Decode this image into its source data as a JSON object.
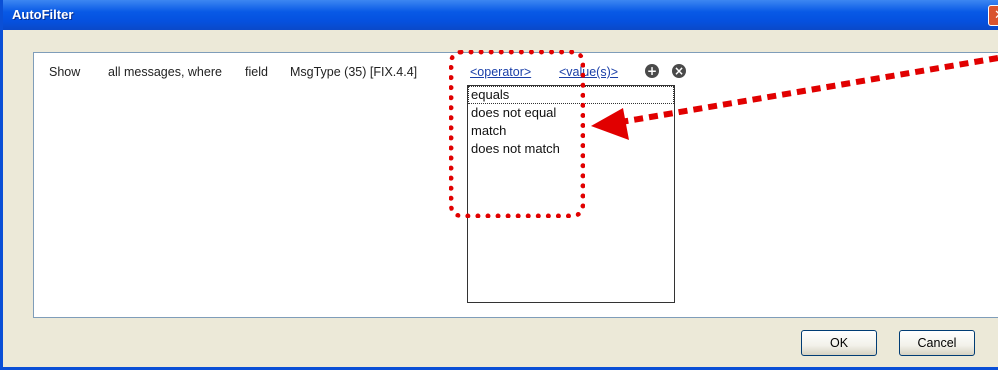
{
  "window": {
    "title": "AutoFilter",
    "close_glyph": "✕"
  },
  "filter_row": {
    "show": "Show",
    "scope": "all messages, where",
    "field_label": "field",
    "field_value": "MsgType (35) [FIX.4.4]",
    "operator_link": "<operator>",
    "value_link": "<value(s)>",
    "add_icon": "add-icon",
    "remove_icon": "remove-icon"
  },
  "operator_options": [
    "equals",
    "does not equal",
    "match",
    "does not match"
  ],
  "selected_option": "equals",
  "buttons": {
    "ok": "OK",
    "cancel": "Cancel"
  },
  "annotation": {
    "color": "#e10000"
  }
}
